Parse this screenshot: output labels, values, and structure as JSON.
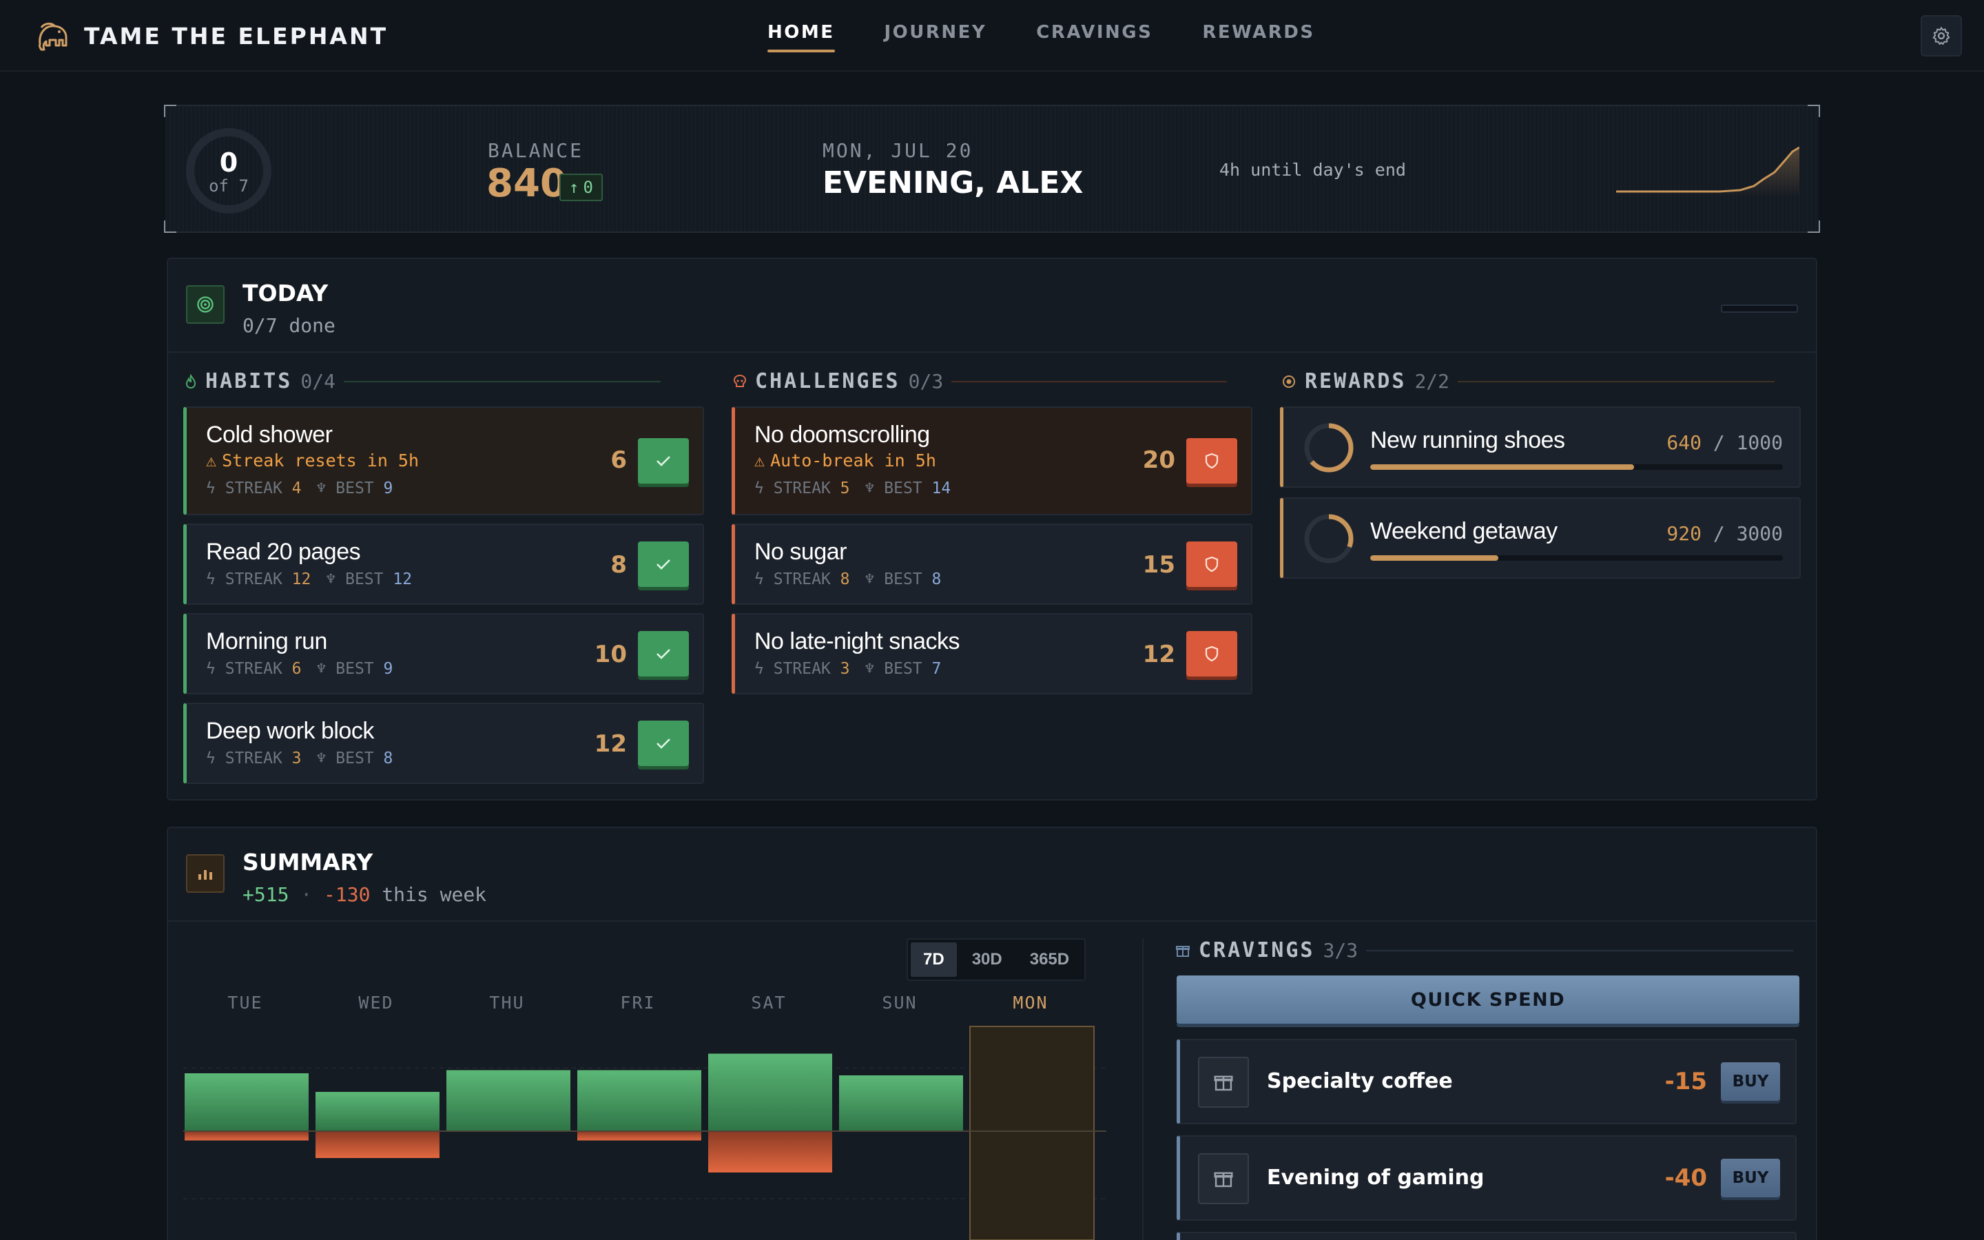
{
  "app": {
    "title": "TAME THE ELEPHANT",
    "nav": [
      "HOME",
      "JOURNEY",
      "CRAVINGS",
      "REWARDS"
    ],
    "active_tab": "HOME"
  },
  "hero": {
    "done": "0",
    "of_total": "of 7",
    "balance_label": "BALANCE",
    "balance": "840",
    "balance_delta": "0",
    "date": "MON, JUL 20",
    "greeting": "EVENING, ALEX",
    "until_end": "4h until day's end"
  },
  "today": {
    "title": "TODAY",
    "subtitle": "0/7 done",
    "habits_label": "HABITS",
    "habits_count": "0/4",
    "challenges_label": "CHALLENGES",
    "challenges_count": "0/3",
    "rewards_label": "REWARDS",
    "rewards_count": "2/2",
    "streak_label": "STREAK",
    "best_label": "BEST",
    "habits": [
      {
        "name": "Cold shower",
        "warning": "Streak resets in 5h",
        "streak": "4",
        "best": "9",
        "points": "6"
      },
      {
        "name": "Read 20 pages",
        "warning": "",
        "streak": "12",
        "best": "12",
        "points": "8"
      },
      {
        "name": "Morning run",
        "warning": "",
        "streak": "6",
        "best": "9",
        "points": "10"
      },
      {
        "name": "Deep work block",
        "warning": "",
        "streak": "3",
        "best": "8",
        "points": "12"
      }
    ],
    "challenges": [
      {
        "name": "No doomscrolling",
        "warning": "Auto-break in 5h",
        "streak": "5",
        "best": "14",
        "points": "20"
      },
      {
        "name": "No sugar",
        "warning": "",
        "streak": "8",
        "best": "8",
        "points": "15"
      },
      {
        "name": "No late-night snacks",
        "warning": "",
        "streak": "3",
        "best": "7",
        "points": "12"
      }
    ],
    "rewards": [
      {
        "name": "New running shoes",
        "current": "640",
        "target": "1000",
        "progress": 0.64
      },
      {
        "name": "Weekend getaway",
        "current": "920",
        "target": "3000",
        "progress": 0.31
      }
    ]
  },
  "summary": {
    "title": "SUMMARY",
    "gain": "+515",
    "sep": "·",
    "loss": "-130",
    "period_text": "this week",
    "ranges": [
      "7D",
      "30D",
      "365D"
    ],
    "active_range": "7D",
    "chart_data": {
      "type": "bar",
      "categories": [
        "TUE",
        "WED",
        "THU",
        "FRI",
        "SAT",
        "SUN",
        "MON"
      ],
      "highlight": "MON",
      "series": [
        {
          "values": [
            112,
            76,
            118,
            118,
            150,
            108,
            0
          ],
          "color": "#4aa868"
        },
        {
          "values": [
            -18,
            -52,
            0,
            -18,
            -80,
            0,
            0
          ],
          "color": "#d86a45"
        }
      ],
      "ylim": [
        -150,
        150
      ],
      "grid": true
    },
    "cravings_label": "CRAVINGS",
    "cravings_count": "3/3",
    "quick_spend": "QUICK SPEND",
    "buy_label": "BUY",
    "cravings": [
      {
        "name": "Specialty coffee",
        "cost": "-15"
      },
      {
        "name": "Evening of gaming",
        "cost": "-40"
      }
    ]
  },
  "colors": {
    "accent": "#c8955a",
    "habit": "#4aa868",
    "challenge": "#d86a45",
    "craving": "#6b87a8"
  }
}
